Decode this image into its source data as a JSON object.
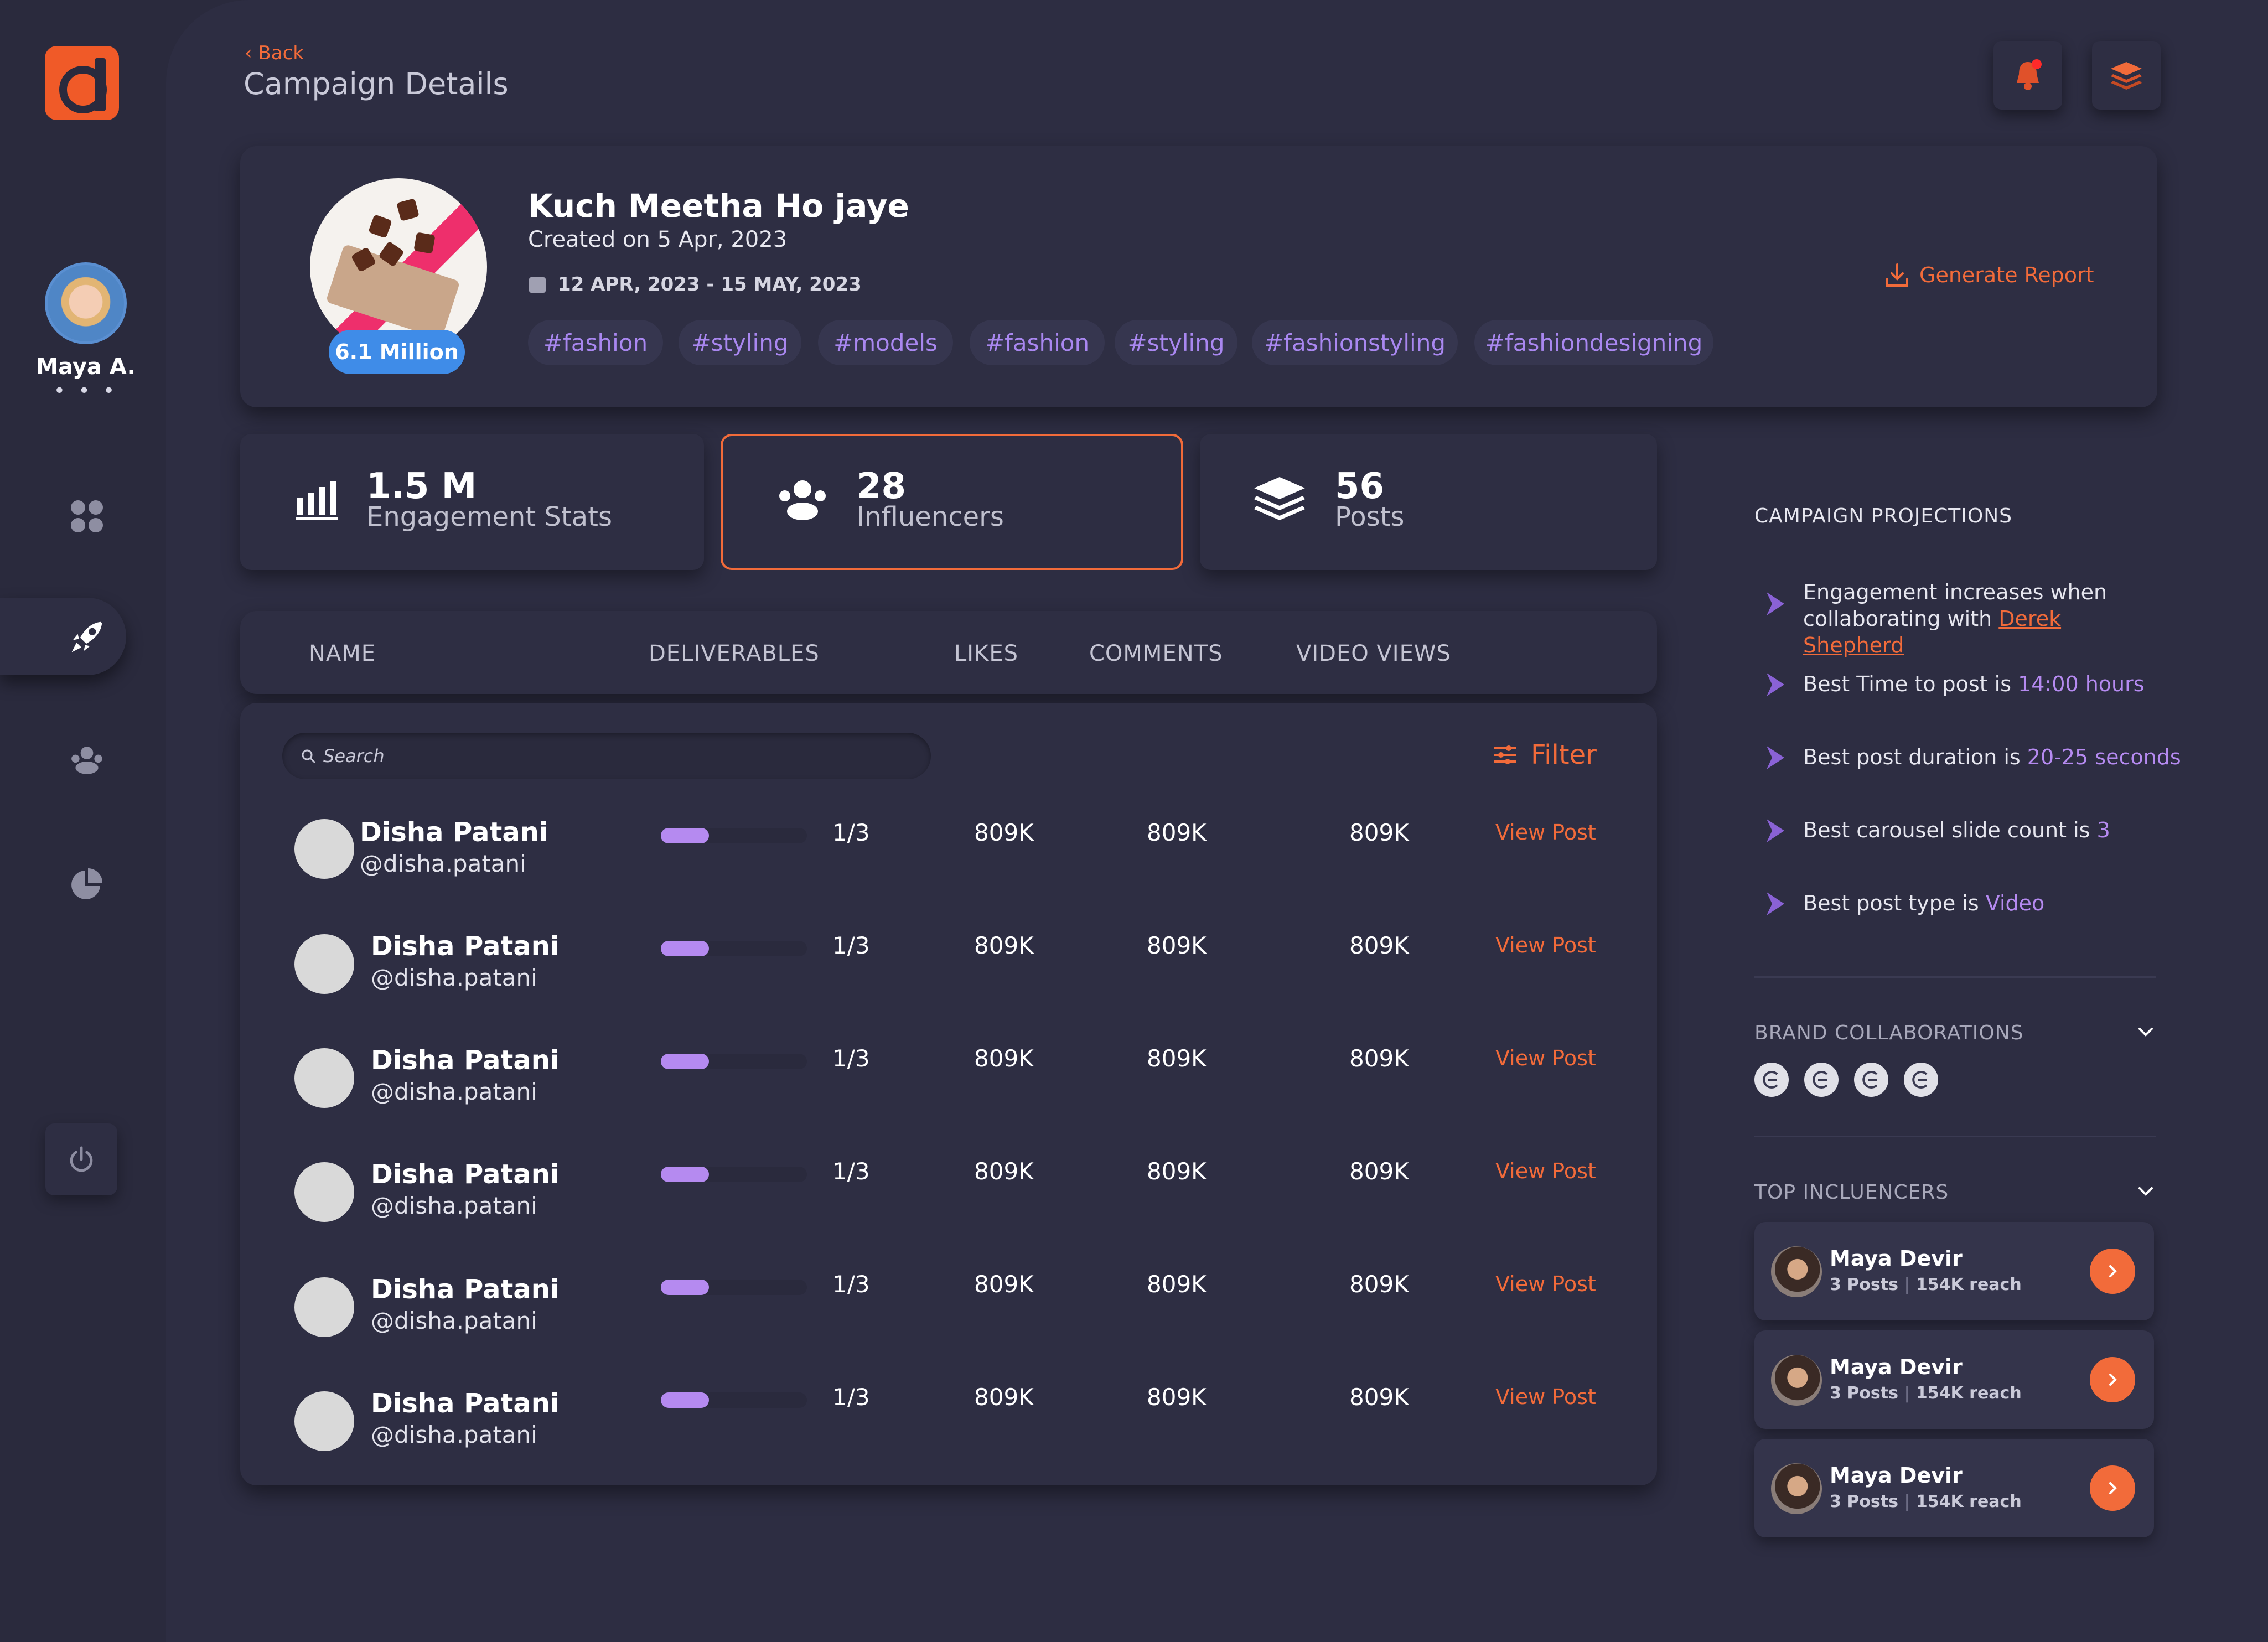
{
  "sidebar": {
    "user_name": "Maya A.",
    "more": "• • •"
  },
  "header": {
    "back_label": "Back",
    "title": "Campaign Details"
  },
  "campaign": {
    "reach_badge": "6.1 Million",
    "name": "Kuch Meetha Ho jaye",
    "created": "Created on 5 Apr, 2023",
    "date_range": "12 APR, 2023 -  15 MAY, 2023",
    "tags": [
      "#fashion",
      "#styling",
      "#models",
      "#fashion",
      "#styling",
      "#fashionstyling",
      "#fashiondesigning"
    ],
    "generate_report": "Generate Report"
  },
  "stats": [
    {
      "value": "1.5 M",
      "label": "Engagement Stats"
    },
    {
      "value": "28",
      "label": "Influencers"
    },
    {
      "value": "56",
      "label": "Posts"
    }
  ],
  "table": {
    "headers": [
      "NAME",
      "DELIVERABLES",
      "LIKES",
      "COMMENTS",
      "VIDEO VIEWS"
    ],
    "search_placeholder": "Search",
    "filter_label": "Filter",
    "rows": [
      {
        "name": "Disha Patani",
        "handle": "@disha.patani",
        "progress": 0.33,
        "deliverables": "1/3",
        "likes": "809K",
        "comments": "809K",
        "views": "809K",
        "action": "View Post"
      },
      {
        "name": "Disha Patani",
        "handle": "@disha.patani",
        "progress": 0.33,
        "deliverables": "1/3",
        "likes": "809K",
        "comments": "809K",
        "views": "809K",
        "action": "View Post"
      },
      {
        "name": "Disha Patani",
        "handle": "@disha.patani",
        "progress": 0.33,
        "deliverables": "1/3",
        "likes": "809K",
        "comments": "809K",
        "views": "809K",
        "action": "View Post"
      },
      {
        "name": "Disha Patani",
        "handle": "@disha.patani",
        "progress": 0.33,
        "deliverables": "1/3",
        "likes": "809K",
        "comments": "809K",
        "views": "809K",
        "action": "View Post"
      },
      {
        "name": "Disha Patani",
        "handle": "@disha.patani",
        "progress": 0.33,
        "deliverables": "1/3",
        "likes": "809K",
        "comments": "809K",
        "views": "809K",
        "action": "View Post"
      },
      {
        "name": "Disha Patani",
        "handle": "@disha.patani",
        "progress": 0.33,
        "deliverables": "1/3",
        "likes": "809K",
        "comments": "809K",
        "views": "809K",
        "action": "View Post"
      }
    ]
  },
  "projections": {
    "title": "CAMPAIGN PROJECTIONS",
    "items": [
      {
        "text": "Engagement increases when collaborating with ",
        "highlight": "Derek Shepherd"
      },
      {
        "text": "Best Time to post is ",
        "highlight": "14:00 hours"
      },
      {
        "text": "Best post duration is ",
        "highlight": "20-25 seconds"
      },
      {
        "text": "Best carousel slide count is ",
        "highlight": "3"
      },
      {
        "text": "Best post type is ",
        "highlight": "Video"
      }
    ]
  },
  "brand_collaborations": {
    "title": "BRAND COLLABORATIONS"
  },
  "top_influencers": {
    "title": "TOP INCLUENCERS",
    "items": [
      {
        "name": "Maya Devir",
        "posts": "3 Posts",
        "reach": "154K reach"
      },
      {
        "name": "Maya Devir",
        "posts": "3 Posts",
        "reach": "154K reach"
      },
      {
        "name": "Maya Devir",
        "posts": "3 Posts",
        "reach": "154K reach"
      }
    ]
  },
  "colors": {
    "accent": "#f26b3a",
    "purple": "#b58af0",
    "bg": "#2d2d42",
    "badge": "#3f8ce8"
  }
}
